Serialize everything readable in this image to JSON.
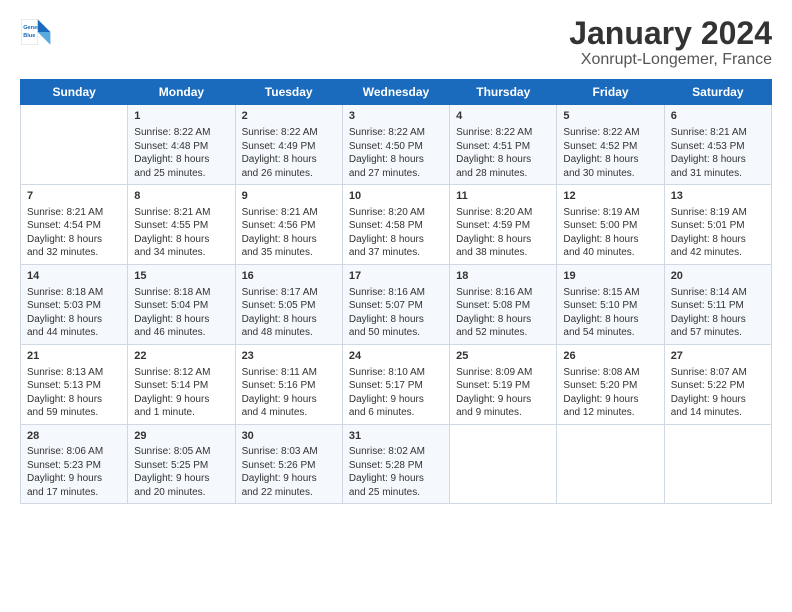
{
  "logo": {
    "line1": "General",
    "line2": "Blue"
  },
  "title": "January 2024",
  "subtitle": "Xonrupt-Longemer, France",
  "header_days": [
    "Sunday",
    "Monday",
    "Tuesday",
    "Wednesday",
    "Thursday",
    "Friday",
    "Saturday"
  ],
  "weeks": [
    [
      {
        "day": "",
        "info": ""
      },
      {
        "day": "1",
        "info": "Sunrise: 8:22 AM\nSunset: 4:48 PM\nDaylight: 8 hours\nand 25 minutes."
      },
      {
        "day": "2",
        "info": "Sunrise: 8:22 AM\nSunset: 4:49 PM\nDaylight: 8 hours\nand 26 minutes."
      },
      {
        "day": "3",
        "info": "Sunrise: 8:22 AM\nSunset: 4:50 PM\nDaylight: 8 hours\nand 27 minutes."
      },
      {
        "day": "4",
        "info": "Sunrise: 8:22 AM\nSunset: 4:51 PM\nDaylight: 8 hours\nand 28 minutes."
      },
      {
        "day": "5",
        "info": "Sunrise: 8:22 AM\nSunset: 4:52 PM\nDaylight: 8 hours\nand 30 minutes."
      },
      {
        "day": "6",
        "info": "Sunrise: 8:21 AM\nSunset: 4:53 PM\nDaylight: 8 hours\nand 31 minutes."
      }
    ],
    [
      {
        "day": "7",
        "info": "Sunrise: 8:21 AM\nSunset: 4:54 PM\nDaylight: 8 hours\nand 32 minutes."
      },
      {
        "day": "8",
        "info": "Sunrise: 8:21 AM\nSunset: 4:55 PM\nDaylight: 8 hours\nand 34 minutes."
      },
      {
        "day": "9",
        "info": "Sunrise: 8:21 AM\nSunset: 4:56 PM\nDaylight: 8 hours\nand 35 minutes."
      },
      {
        "day": "10",
        "info": "Sunrise: 8:20 AM\nSunset: 4:58 PM\nDaylight: 8 hours\nand 37 minutes."
      },
      {
        "day": "11",
        "info": "Sunrise: 8:20 AM\nSunset: 4:59 PM\nDaylight: 8 hours\nand 38 minutes."
      },
      {
        "day": "12",
        "info": "Sunrise: 8:19 AM\nSunset: 5:00 PM\nDaylight: 8 hours\nand 40 minutes."
      },
      {
        "day": "13",
        "info": "Sunrise: 8:19 AM\nSunset: 5:01 PM\nDaylight: 8 hours\nand 42 minutes."
      }
    ],
    [
      {
        "day": "14",
        "info": "Sunrise: 8:18 AM\nSunset: 5:03 PM\nDaylight: 8 hours\nand 44 minutes."
      },
      {
        "day": "15",
        "info": "Sunrise: 8:18 AM\nSunset: 5:04 PM\nDaylight: 8 hours\nand 46 minutes."
      },
      {
        "day": "16",
        "info": "Sunrise: 8:17 AM\nSunset: 5:05 PM\nDaylight: 8 hours\nand 48 minutes."
      },
      {
        "day": "17",
        "info": "Sunrise: 8:16 AM\nSunset: 5:07 PM\nDaylight: 8 hours\nand 50 minutes."
      },
      {
        "day": "18",
        "info": "Sunrise: 8:16 AM\nSunset: 5:08 PM\nDaylight: 8 hours\nand 52 minutes."
      },
      {
        "day": "19",
        "info": "Sunrise: 8:15 AM\nSunset: 5:10 PM\nDaylight: 8 hours\nand 54 minutes."
      },
      {
        "day": "20",
        "info": "Sunrise: 8:14 AM\nSunset: 5:11 PM\nDaylight: 8 hours\nand 57 minutes."
      }
    ],
    [
      {
        "day": "21",
        "info": "Sunrise: 8:13 AM\nSunset: 5:13 PM\nDaylight: 8 hours\nand 59 minutes."
      },
      {
        "day": "22",
        "info": "Sunrise: 8:12 AM\nSunset: 5:14 PM\nDaylight: 9 hours\nand 1 minute."
      },
      {
        "day": "23",
        "info": "Sunrise: 8:11 AM\nSunset: 5:16 PM\nDaylight: 9 hours\nand 4 minutes."
      },
      {
        "day": "24",
        "info": "Sunrise: 8:10 AM\nSunset: 5:17 PM\nDaylight: 9 hours\nand 6 minutes."
      },
      {
        "day": "25",
        "info": "Sunrise: 8:09 AM\nSunset: 5:19 PM\nDaylight: 9 hours\nand 9 minutes."
      },
      {
        "day": "26",
        "info": "Sunrise: 8:08 AM\nSunset: 5:20 PM\nDaylight: 9 hours\nand 12 minutes."
      },
      {
        "day": "27",
        "info": "Sunrise: 8:07 AM\nSunset: 5:22 PM\nDaylight: 9 hours\nand 14 minutes."
      }
    ],
    [
      {
        "day": "28",
        "info": "Sunrise: 8:06 AM\nSunset: 5:23 PM\nDaylight: 9 hours\nand 17 minutes."
      },
      {
        "day": "29",
        "info": "Sunrise: 8:05 AM\nSunset: 5:25 PM\nDaylight: 9 hours\nand 20 minutes."
      },
      {
        "day": "30",
        "info": "Sunrise: 8:03 AM\nSunset: 5:26 PM\nDaylight: 9 hours\nand 22 minutes."
      },
      {
        "day": "31",
        "info": "Sunrise: 8:02 AM\nSunset: 5:28 PM\nDaylight: 9 hours\nand 25 minutes."
      },
      {
        "day": "",
        "info": ""
      },
      {
        "day": "",
        "info": ""
      },
      {
        "day": "",
        "info": ""
      }
    ]
  ]
}
